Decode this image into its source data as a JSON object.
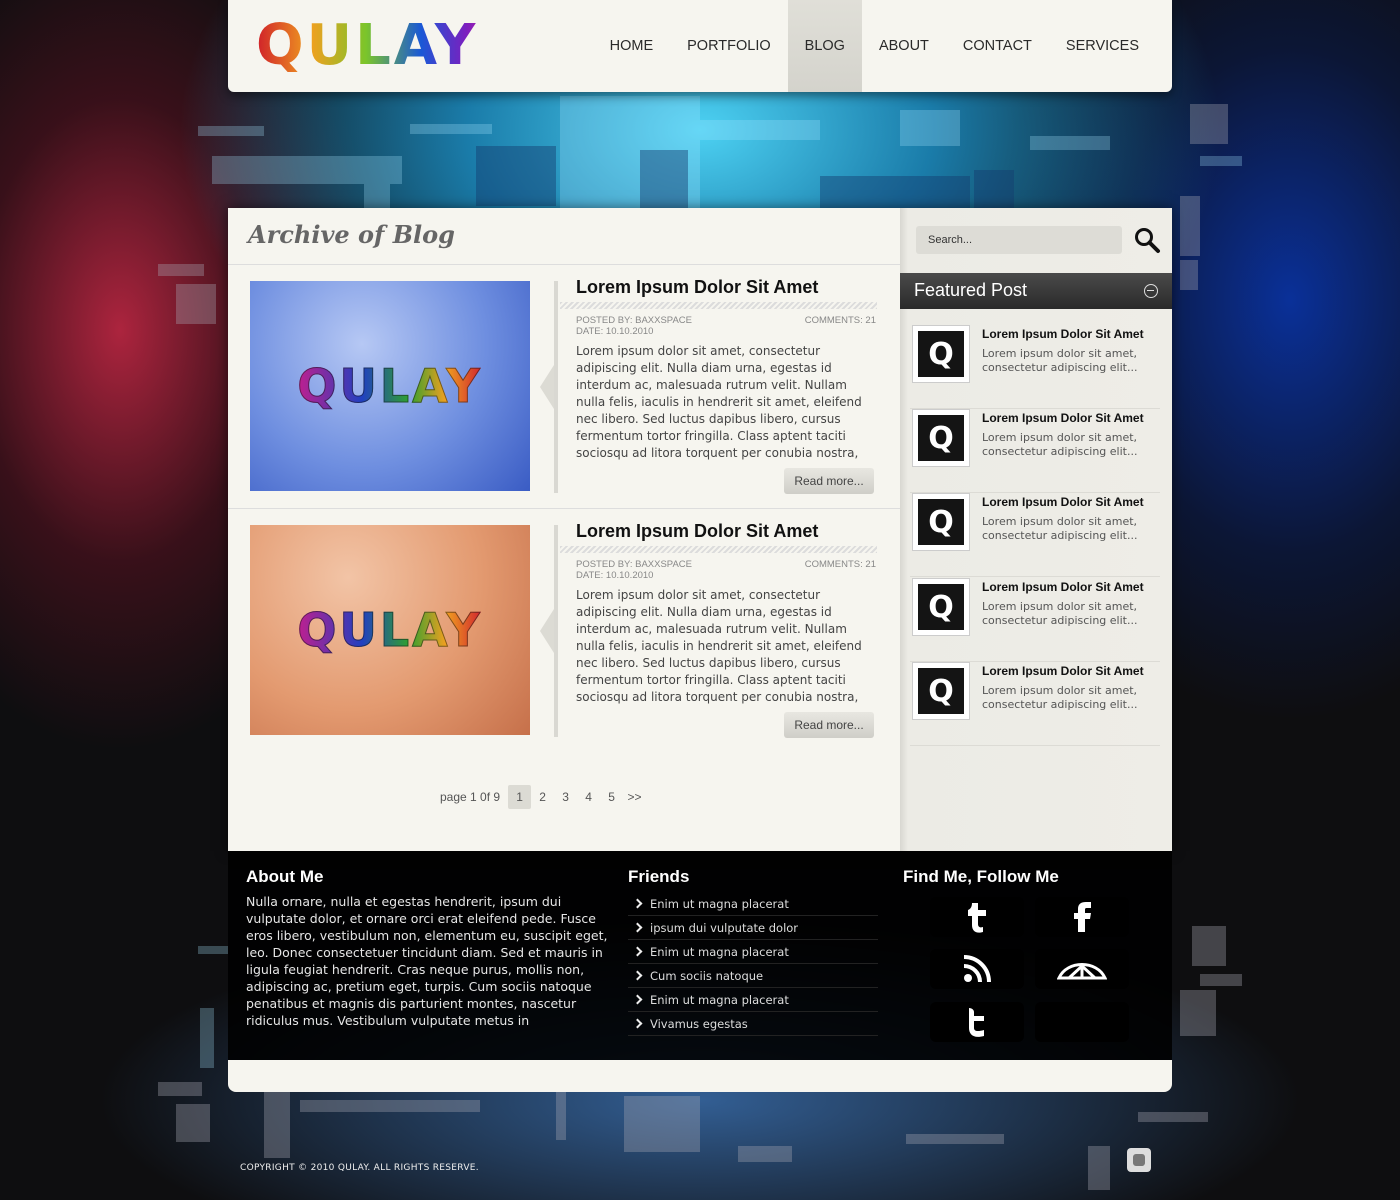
{
  "brand": {
    "logo_text": "QULAY"
  },
  "nav": {
    "items": [
      {
        "label": "HOME"
      },
      {
        "label": "PORTFOLIO"
      },
      {
        "label": "BLOG"
      },
      {
        "label": "ABOUT"
      },
      {
        "label": "CONTACT"
      },
      {
        "label": "SERVICES"
      }
    ],
    "active": "BLOG"
  },
  "archive": {
    "title": "Archive of Blog"
  },
  "posts": [
    {
      "thumb_text": "QULAY",
      "title": "Lorem Ipsum Dolor Sit Amet",
      "posted_by": "POSTED BY:  BAXXSPACE",
      "date": "DATE: 10.10.2010",
      "comments": "COMMENTS: 21",
      "excerpt": "Lorem ipsum dolor sit amet, consectetur adipiscing elit. Nulla diam urna, egestas id interdum ac, malesuada rutrum velit. Nullam nulla felis, iaculis in hendrerit sit amet, eleifend nec libero. Sed luctus dapibus libero, cursus fermentum tortor fringilla. Class aptent taciti sociosqu ad litora torquent per conubia nostra,",
      "read_more": "Read more..."
    },
    {
      "thumb_text": "QULAY",
      "title": "Lorem Ipsum Dolor Sit Amet",
      "posted_by": "POSTED BY:  BAXXSPACE",
      "date": "DATE: 10.10.2010",
      "comments": "COMMENTS: 21",
      "excerpt": "Lorem ipsum dolor sit amet, consectetur adipiscing elit. Nulla diam urna, egestas id interdum ac, malesuada rutrum velit. Nullam nulla felis, iaculis in hendrerit sit amet, eleifend nec libero. Sed luctus dapibus libero, cursus fermentum tortor fringilla. Class aptent taciti sociosqu ad litora torquent per conubia nostra,",
      "read_more": "Read more..."
    }
  ],
  "pagination": {
    "label": "page 1 0f 9",
    "pages": [
      "1",
      "2",
      "3",
      "4",
      "5",
      ">>"
    ],
    "current": "1"
  },
  "sidebar": {
    "search_placeholder": "Search...",
    "featured_title": "Featured Post",
    "featured_posts": [
      {
        "thumb_letter": "Q",
        "title": "Lorem Ipsum Dolor Sit Amet",
        "text": "Lorem ipsum dolor sit amet, consectetur adipiscing elit..."
      },
      {
        "thumb_letter": "Q",
        "title": "Lorem Ipsum Dolor Sit Amet",
        "text": "Lorem ipsum dolor sit amet, consectetur adipiscing elit..."
      },
      {
        "thumb_letter": "Q",
        "title": "Lorem Ipsum Dolor Sit Amet",
        "text": "Lorem ipsum dolor sit amet, consectetur adipiscing elit..."
      },
      {
        "thumb_letter": "Q",
        "title": "Lorem Ipsum Dolor Sit Amet",
        "text": "Lorem ipsum dolor sit amet, consectetur adipiscing elit..."
      },
      {
        "thumb_letter": "Q",
        "title": "Lorem Ipsum Dolor Sit Amet",
        "text": "Lorem ipsum dolor sit amet, consectetur adipiscing elit..."
      }
    ]
  },
  "footer": {
    "about_title": "About Me",
    "about_text": "Nulla ornare, nulla et egestas hendrerit, ipsum dui vulputate dolor, et ornare orci erat eleifend pede. Fusce eros libero, vestibulum non, elementum eu, suscipit eget, leo. Donec consectetuer tincidunt diam. Sed et mauris in ligula feugiat hendrerit. Cras neque purus, mollis non, adipiscing ac, pretium eget, turpis. Cum sociis natoque penatibus et magnis dis parturient montes, nascetur ridiculus mus. Vestibulum vulputate metus in",
    "friends_title": "Friends",
    "friends": [
      "Enim ut magna placerat",
      "ipsum dui vulputate dolor",
      "Enim ut magna placerat",
      "Cum sociis natoque",
      "Enim ut magna placerat",
      "Vivamus egestas"
    ],
    "follow_title": "Find Me, Follow Me",
    "social_icons": [
      "tumblr-icon",
      "facebook-icon",
      "rss-icon",
      "deviantart-icon",
      "twitter-icon",
      "blank"
    ],
    "copyright": "COPYRIGHT © 2010 QULAY. ALL RIGHTS RESERVE."
  },
  "colors": {
    "panel": "#f6f5ef",
    "accent_cyan": "#4fd8ff",
    "accent_red": "#c8284a",
    "footer_bg": "#000000"
  }
}
